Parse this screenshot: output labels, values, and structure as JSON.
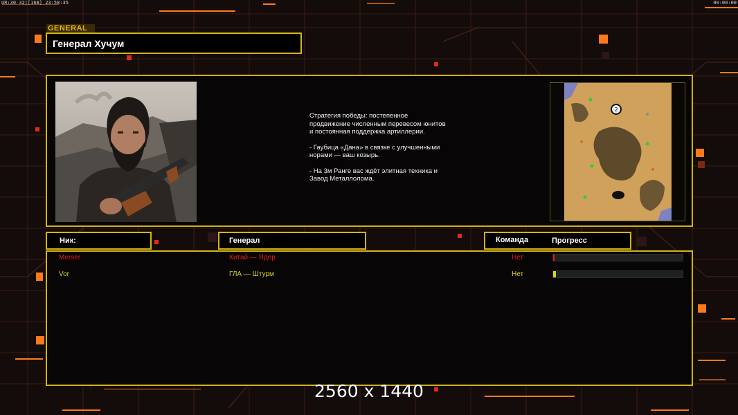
{
  "hud": {
    "top_left": "UR:30 32|[16B] 23:58:35",
    "top_right": "00:00:00"
  },
  "colors": {
    "accent": "#d4b317",
    "player1": "#e01c1c",
    "player2": "#d6d21e",
    "orange": "#ff7a1a"
  },
  "general": {
    "tag": "GENERAL",
    "name": "Генерал Хучум",
    "portrait_icon": "general-portrait",
    "briefing": [
      "Стратегия победы: постепенное продвижение численным перевесом юнитов и постоянная поддержка артиллерии.",
      "- Гаубица «Дана» в связке с улучшенными норами — ваш козырь.",
      "- На 3м Ранге вас ждёт элитная техника и Завод Металлолома."
    ],
    "minimap": {
      "icon": "map-preview",
      "marker_label": "2"
    }
  },
  "table": {
    "headers": {
      "nick": "Ник:",
      "general": "Генерал",
      "team": "Команда",
      "progress": "Прогресс"
    },
    "rows": [
      {
        "nick": "Merser",
        "general": "Китай — Ядер",
        "team": "Нет",
        "progress": 0.01,
        "color": "#e01c1c"
      },
      {
        "nick": "Vor",
        "general": "ГЛА — Штурм",
        "team": "Нет",
        "progress": 0.02,
        "color": "#d6d21e"
      }
    ]
  },
  "resolution": "2560 x 1440"
}
